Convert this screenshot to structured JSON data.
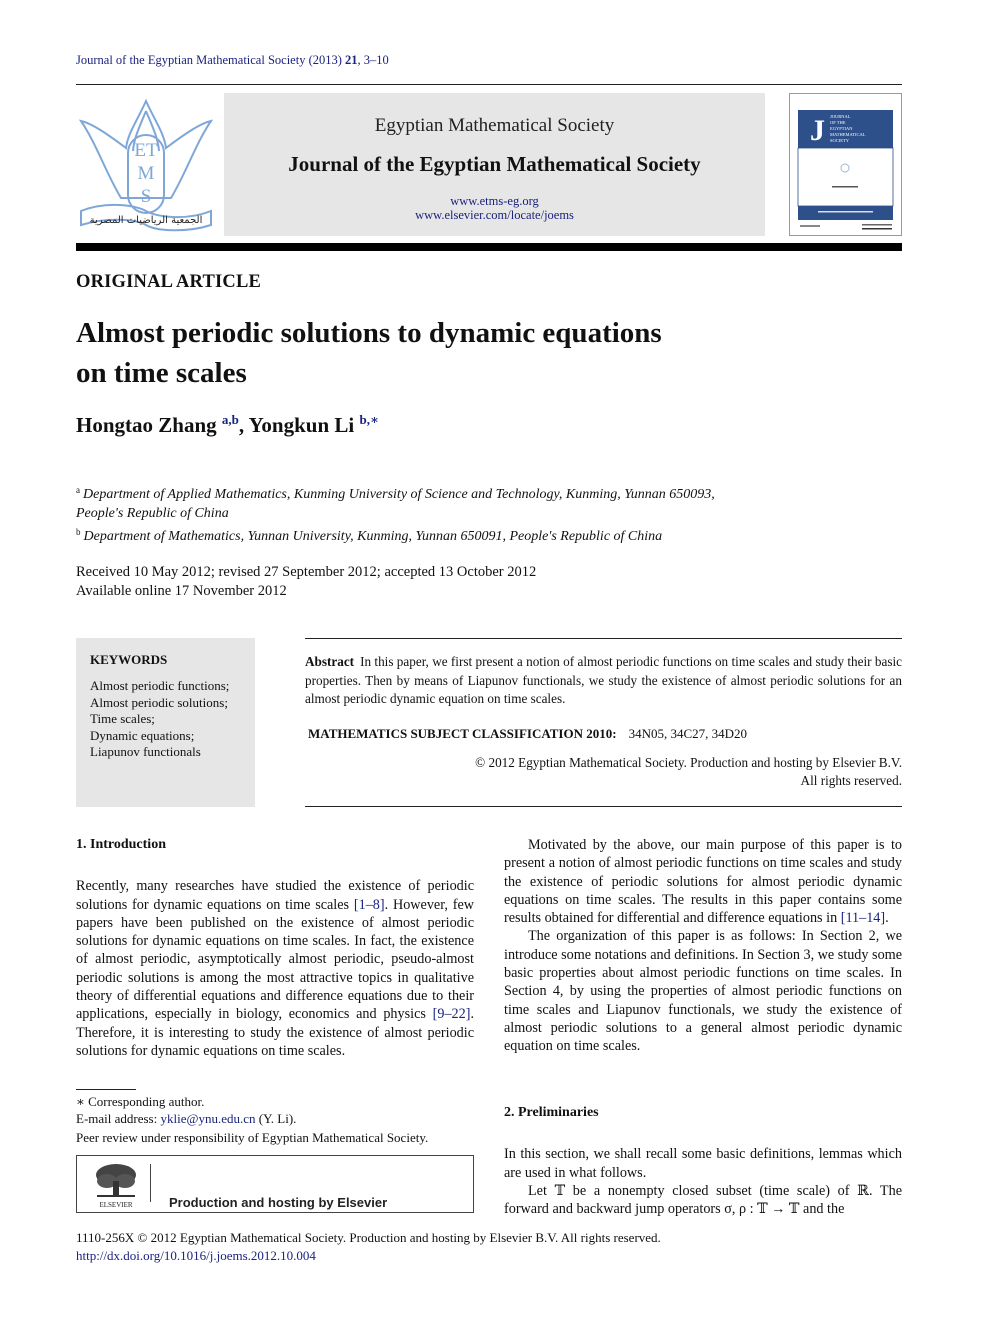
{
  "running_head": {
    "journal": "Journal of the Egyptian Mathematical Society (2013) ",
    "volume": "21",
    "pages": ", 3–10"
  },
  "header": {
    "logo_letters": [
      "ET",
      "M",
      "S"
    ],
    "logo_arabic": "الجمعية الرياضيات المصرية",
    "society": "Egyptian Mathematical Society",
    "journal": "Journal of the Egyptian Mathematical Society",
    "links": [
      "www.etms-eg.org",
      "www.elsevier.com/locate/joems"
    ],
    "cover_letter": "J",
    "cover_title_lines": [
      "JOURNAL",
      "OF THE",
      "EGYPTIAN",
      "MATHEMATICAL",
      "SOCIETY"
    ]
  },
  "article": {
    "type": "ORIGINAL ARTICLE",
    "title_line1": "Almost periodic solutions to dynamic equations",
    "title_line2": "on time scales",
    "authors": [
      {
        "name": "Hongtao Zhang",
        "sup": "a,b"
      },
      {
        "name": "Yongkun Li",
        "sup": "b,∗"
      }
    ],
    "affiliations": [
      {
        "mark": "a",
        "line1": "Department of Applied Mathematics, Kunming University of Science and Technology, Kunming, Yunnan 650093,",
        "line2": "People's Republic of China"
      },
      {
        "mark": "b",
        "line1": "Department of Mathematics, Yunnan University, Kunming, Yunnan 650091, People's Republic of China"
      }
    ],
    "received": "Received 10 May 2012; revised 27 September 2012; accepted 13 October 2012",
    "available": "Available online 17 November 2012"
  },
  "keywords": {
    "title": "KEYWORDS",
    "items": [
      "Almost periodic functions;",
      "Almost periodic solutions;",
      "Time scales;",
      "Dynamic equations;",
      "Liapunov functionals"
    ]
  },
  "abstract": {
    "label": "Abstract",
    "text": "In this paper, we first present a notion of almost periodic functions on time scales and study their basic properties. Then by means of Liapunov functionals, we study the existence of almost periodic solutions for an almost periodic dynamic equation on time scales.",
    "msc_label": "MATHEMATICS SUBJECT CLASSIFICATION 2010:",
    "msc_codes": "34N05, 34C27, 34D20",
    "copyright_line1": "© 2012 Egyptian Mathematical Society. Production and hosting by Elsevier B.V.",
    "copyright_line2": "All rights reserved."
  },
  "intro": {
    "heading": "1. Introduction",
    "p1_a": "Recently, many researches have studied the existence of periodic solutions for dynamic equations on time scales ",
    "p1_ref1": "[1–8]",
    "p1_b": ". However, few papers have been published on the existence of almost periodic solutions for dynamic equations on time scales. In fact, the existence of almost periodic, asymptotically almost periodic, pseudo-almost periodic solutions is among the most attractive topics in qualitative theory of differential equations and difference equations due to their applications, especially in biology, economics and physics ",
    "p1_ref2": "[9–22]",
    "p1_c": ". Therefore, it is interesting to study the existence of almost periodic solutions for dynamic equations on time scales.",
    "p2_a": "Motivated by the above, our main purpose of this paper is to present a notion of almost periodic functions on time scales and study the existence of periodic solutions for almost periodic dynamic equations on time scales. The results in this paper contains some results obtained for differential and difference equations in ",
    "p2_ref": "[11–14]",
    "p2_b": ".",
    "p3": "The organization of this paper is as follows: In Section 2, we introduce some notations and definitions. In Section 3, we study some basic properties about almost periodic functions on time scales. In Section 4, by using the properties of almost periodic functions on time scales and Liapunov functionals, we study the existence of almost periodic solutions to a general almost periodic dynamic equation on time scales."
  },
  "prelim": {
    "heading": "2. Preliminaries",
    "p1": "In this section, we shall recall some basic definitions, lemmas which are used in what follows.",
    "p2": "Let 𝕋 be a nonempty closed subset (time scale) of ℝ. The forward and backward jump operators σ, ρ : 𝕋 → 𝕋 and the"
  },
  "footnotes": {
    "corresponding": "∗ Corresponding author.",
    "email_label": "E-mail address: ",
    "email": "yklie@ynu.edu.cn",
    "email_suffix": " (Y. Li).",
    "peer_review": "Peer review under responsibility of Egyptian Mathematical Society."
  },
  "elsevier_box": {
    "logo_label": "ELSEVIER",
    "text": "Production and hosting by Elsevier"
  },
  "bottom": {
    "issn": "1110-256X © 2012 Egyptian Mathematical Society. Production and hosting by Elsevier B.V. All rights reserved.",
    "doi": "http://dx.doi.org/10.1016/j.joems.2012.10.004"
  }
}
